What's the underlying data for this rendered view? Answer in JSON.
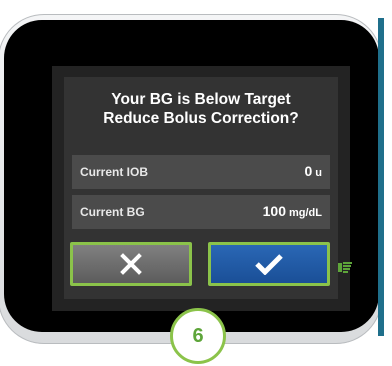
{
  "dialog": {
    "title_line1": "Your BG is Below Target",
    "title_line2": "Reduce Bolus Correction?"
  },
  "rows": [
    {
      "label": "Current IOB",
      "value": "0",
      "unit": "u"
    },
    {
      "label": "Current BG",
      "value": "100",
      "unit": "mg/dL"
    }
  ],
  "buttons": {
    "cancel_icon": "x-icon",
    "confirm_icon": "checkmark-icon"
  },
  "step_badge": "6",
  "colors": {
    "accent_green": "#8bc34a",
    "confirm_blue": "#1f5ea8",
    "panel": "#333333"
  }
}
